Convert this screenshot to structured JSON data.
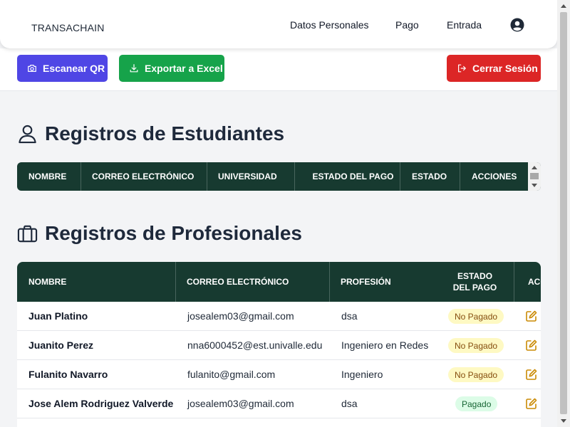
{
  "navbar": {
    "brand": "TRANSACHAIN",
    "links": [
      "Datos Personales",
      "Pago",
      "Entrada"
    ],
    "user_icon": "user-circle-icon"
  },
  "toolbar": {
    "scan_label": "Escanear QR",
    "export_label": "Exportar a Excel",
    "logout_label": "Cerrar Sesión"
  },
  "students": {
    "title": "Registros de Estudiantes",
    "icon": "user-icon",
    "columns": [
      "NOMBRE",
      "CORREO ELECTRÓNICO",
      "UNIVERSIDAD",
      "ESTADO DEL PAGO",
      "ESTADO",
      "ACCIONES"
    ]
  },
  "professionals": {
    "title": "Registros de Profesionales",
    "icon": "briefcase-icon",
    "columns": [
      "NOMBRE",
      "CORREO ELECTRÓNICO",
      "PROFESIÓN",
      "ESTADO DEL PAGO",
      "ACCIONES"
    ],
    "rows": [
      {
        "name": "Juan Platino",
        "email": "josealem03@gmail.com",
        "profession": "dsa",
        "status": "No Pagado"
      },
      {
        "name": "Juanito Perez",
        "email": "nna6000452@est.univalle.edu",
        "profession": "Ingeniero en Redes",
        "status": "No Pagado"
      },
      {
        "name": "Fulanito Navarro",
        "email": "fulanito@gmail.com",
        "profession": "Ingeniero",
        "status": "No Pagado"
      },
      {
        "name": "Jose Alem Rodriguez Valverde",
        "email": "josealem03@gmail.com",
        "profession": "dsa",
        "status": "Pagado"
      }
    ]
  },
  "colors": {
    "header_bg": "#173a30",
    "scan_button": "#4f46e5",
    "export_button": "#16a34a",
    "logout_button": "#dc2626",
    "edit_icon": "#ca8a04"
  }
}
